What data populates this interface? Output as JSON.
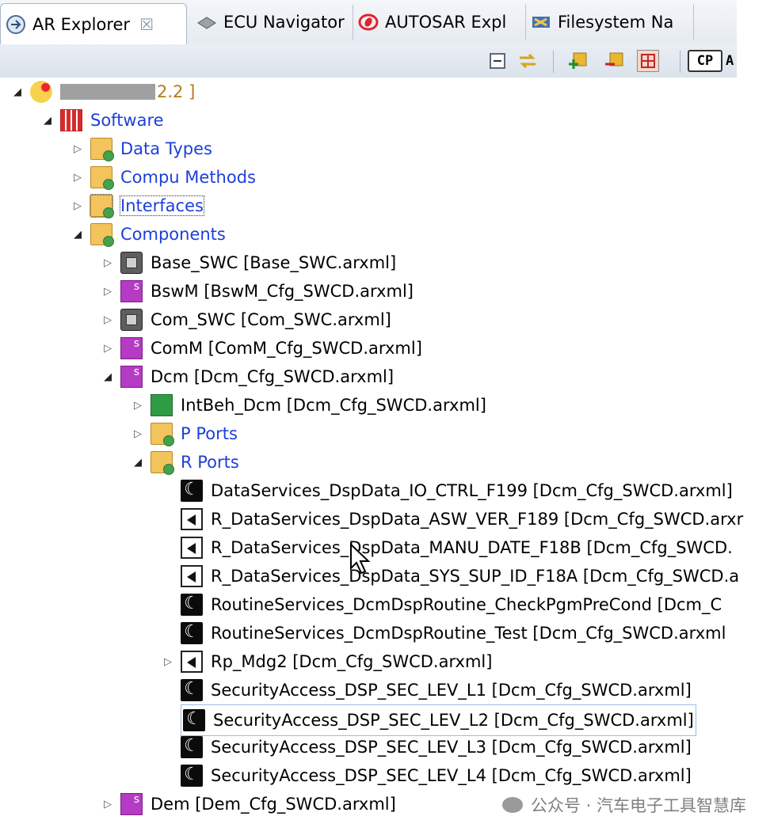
{
  "tabs": [
    {
      "label": "AR Explorer",
      "icon": "ar-explorer-icon",
      "active": true,
      "close": "☒"
    },
    {
      "label": "ECU Navigator",
      "icon": "ecu-navigator-icon"
    },
    {
      "label": "AUTOSAR Expl",
      "icon": "autosar-explorer-icon"
    },
    {
      "label": "Filesystem Na",
      "icon": "filesystem-navigator-icon"
    }
  ],
  "toolbar": {
    "buttons": [
      "collapse-all-icon",
      "link-with-editor-icon",
      "add-component-icon",
      "remove-component-icon",
      "grid-view-icon"
    ],
    "cp_label": "CP",
    "trailing_label": "A"
  },
  "tree": {
    "root": {
      "suffix": "2.2 ]"
    },
    "software": "Software",
    "data_types": "Data Types",
    "compu_methods": "Compu Methods",
    "interfaces": "Interfaces",
    "components": "Components",
    "base_swc": "Base_SWC [Base_SWC.arxml]",
    "bswm": "BswM [BswM_Cfg_SWCD.arxml]",
    "com_swc": "Com_SWC [Com_SWC.arxml]",
    "comm": "ComM [ComM_Cfg_SWCD.arxml]",
    "dcm": "Dcm [Dcm_Cfg_SWCD.arxml]",
    "intbeh_dcm": "IntBeh_Dcm [Dcm_Cfg_SWCD.arxml]",
    "p_ports": "P Ports",
    "r_ports": "R Ports",
    "port_1": "DataServices_DspData_IO_CTRL_F199 [Dcm_Cfg_SWCD.arxml]",
    "port_2": "R_DataServices_DspData_ASW_VER_F189 [Dcm_Cfg_SWCD.arxr",
    "port_3": "R_DataServices_DspData_MANU_DATE_F18B [Dcm_Cfg_SWCD.",
    "port_4": "R_DataServices_DspData_SYS_SUP_ID_F18A [Dcm_Cfg_SWCD.a",
    "port_5": "RoutineServices_DcmDspRoutine_CheckPgmPreCond [Dcm_C",
    "port_6": "RoutineServices_DcmDspRoutine_Test [Dcm_Cfg_SWCD.arxml",
    "port_7": "Rp_Mdg2 [Dcm_Cfg_SWCD.arxml]",
    "port_8": "SecurityAccess_DSP_SEC_LEV_L1 [Dcm_Cfg_SWCD.arxml]",
    "port_9": "SecurityAccess_DSP_SEC_LEV_L2 [Dcm_Cfg_SWCD.arxml]",
    "port_10": "SecurityAccess_DSP_SEC_LEV_L3 [Dcm_Cfg_SWCD.arxml]",
    "port_11": "SecurityAccess_DSP_SEC_LEV_L4 [Dcm_Cfg_SWCD.arxml]",
    "dem": "Dem [Dem_Cfg_SWCD.arxml]"
  },
  "watermark": "公众号 · 汽车电子工具智慧库",
  "colors": {
    "package_text": "#1d3fd8",
    "selection_border": "#9bbbe4"
  }
}
